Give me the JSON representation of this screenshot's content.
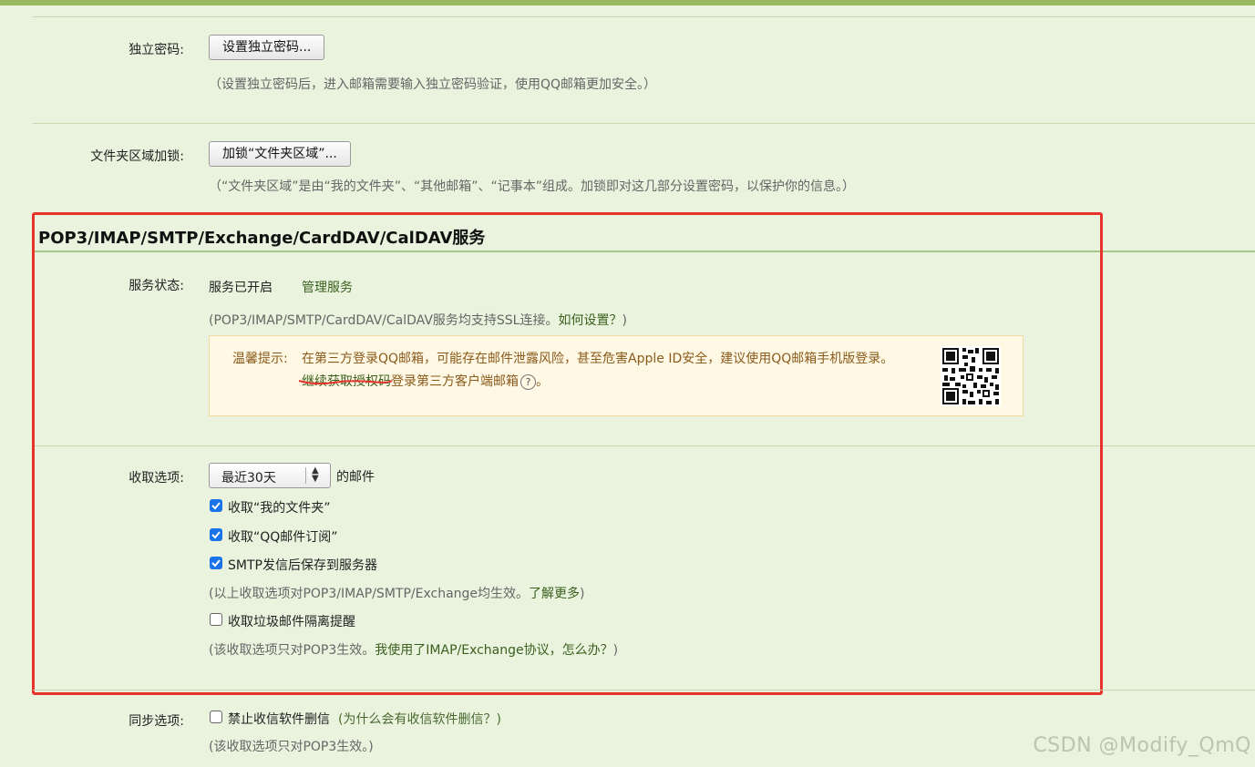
{
  "independent_password": {
    "label": "独立密码:",
    "button": "设置独立密码...",
    "hint": "（设置独立密码后，进入邮箱需要输入独立密码验证，使用QQ邮箱更加安全。）"
  },
  "folder_lock": {
    "label": "文件夹区域加锁:",
    "button": "加锁“文件夹区域”...",
    "hint": "（“文件夹区域”是由“我的文件夹”、“其他邮箱”、“记事本”组成。加锁即对这几部分设置密码，以保护你的信息。）"
  },
  "service_section": {
    "title": "POP3/IMAP/SMTP/Exchange/CardDAV/CalDAV服务",
    "status_label": "服务状态:",
    "status_value": "服务已开启",
    "manage_link": "管理服务",
    "ssl_hint_prefix": "(POP3/IMAP/SMTP/CardDAV/CalDAV服务均支持SSL连接。",
    "ssl_hint_link": "如何设置？",
    "ssl_hint_suffix": ")",
    "warning": {
      "prefix": "温馨提示:",
      "line1": "在第三方登录QQ邮箱，可能存在邮件泄露风险，甚至危害Apple ID安全，建议使用QQ邮箱手机版登录。",
      "auth_link": "继续获取授权码",
      "line2_suffix": "登录第三方客户端邮箱",
      "line2_end": "。",
      "help_glyph": "?"
    }
  },
  "fetch_options": {
    "label": "收取选项:",
    "select_value": "最近30天",
    "select_suffix": "的邮件",
    "checkboxes": [
      {
        "label": "收取“我的文件夹”",
        "checked": true
      },
      {
        "label": "收取“QQ邮件订阅”",
        "checked": true
      },
      {
        "label": "SMTP发信后保存到服务器",
        "checked": true
      }
    ],
    "hint1_prefix": "(以上收取选项对POP3/IMAP/SMTP/Exchange均生效。",
    "hint1_link": "了解更多",
    "hint1_suffix": ")",
    "spam_checkbox": {
      "label": "收取垃圾邮件隔离提醒",
      "checked": false
    },
    "hint2_prefix": "(该收取选项只对POP3生效。",
    "hint2_link": "我使用了IMAP/Exchange协议，怎么办？",
    "hint2_suffix": ")"
  },
  "sync_options": {
    "label": "同步选项:",
    "checkbox": {
      "label": "禁止收信软件删信",
      "checked": false
    },
    "why_link": "(为什么会有收信软件删信？)",
    "hint": "(该收取选项只对POP3生效。)"
  },
  "watermark": "CSDN @Modify_QmQ",
  "colors": {
    "background": "#e9f3dd",
    "highlight_box": "#e8322c",
    "checkbox_checked": "#1a73e8",
    "warning_bg": "#fff8e4",
    "warning_text": "#8a5a1b"
  }
}
